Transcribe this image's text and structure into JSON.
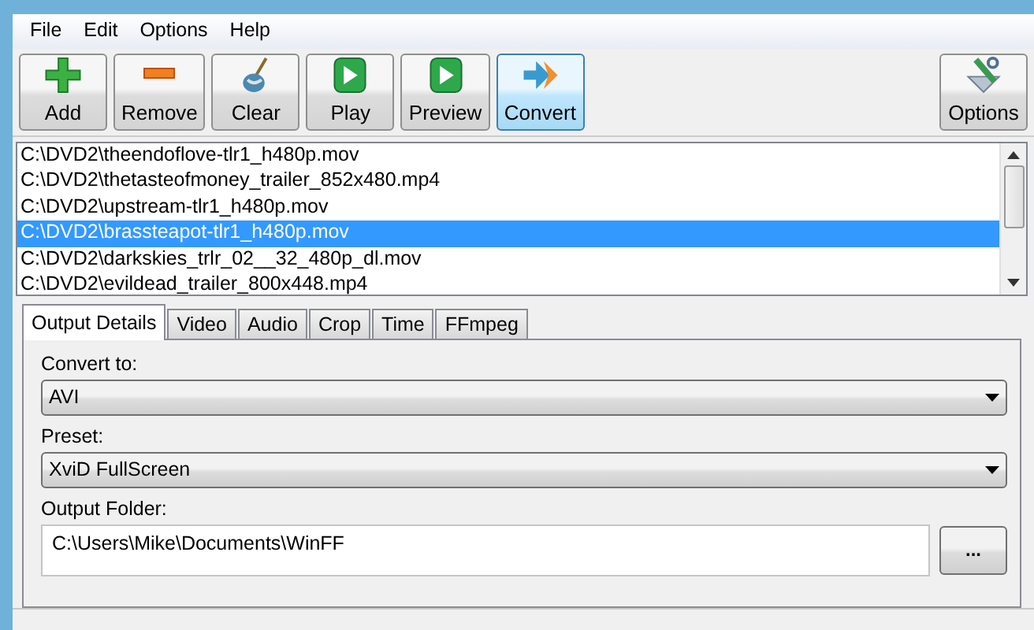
{
  "menu": [
    "File",
    "Edit",
    "Options",
    "Help"
  ],
  "toolbar": [
    {
      "label": "Add",
      "kind": "plus",
      "highlighted": false
    },
    {
      "label": "Remove",
      "kind": "minus",
      "highlighted": false
    },
    {
      "label": "Clear",
      "kind": "broom",
      "highlighted": false
    },
    {
      "label": "Play",
      "kind": "play",
      "highlighted": false
    },
    {
      "label": "Preview",
      "kind": "play",
      "highlighted": false
    },
    {
      "label": "Convert",
      "kind": "arrows",
      "highlighted": true
    }
  ],
  "options_button": {
    "label": "Options",
    "kind": "tools"
  },
  "files": [
    {
      "path": "C:\\DVD2\\theendoflove-tlr1_h480p.mov",
      "selected": false
    },
    {
      "path": "C:\\DVD2\\thetasteofmoney_trailer_852x480.mp4",
      "selected": false
    },
    {
      "path": "C:\\DVD2\\upstream-tlr1_h480p.mov",
      "selected": false
    },
    {
      "path": "C:\\DVD2\\brassteapot-tlr1_h480p.mov",
      "selected": true
    },
    {
      "path": "C:\\DVD2\\darkskies_trlr_02__32_480p_dl.mov",
      "selected": false
    },
    {
      "path": "C:\\DVD2\\evildead_trailer_800x448.mp4",
      "selected": false
    }
  ],
  "tabs": [
    {
      "label": "Output Details",
      "selected": true
    },
    {
      "label": "Video",
      "selected": false
    },
    {
      "label": "Audio",
      "selected": false
    },
    {
      "label": "Crop",
      "selected": false
    },
    {
      "label": "Time",
      "selected": false
    },
    {
      "label": "FFmpeg",
      "selected": false
    }
  ],
  "convert_to": {
    "label": "Convert to:",
    "value": "AVI"
  },
  "preset": {
    "label": "Preset:",
    "value": "XviD FullScreen"
  },
  "output_folder": {
    "label": "Output Folder:",
    "value": "C:\\Users\\Mike\\Documents\\WinFF",
    "browse": "..."
  }
}
